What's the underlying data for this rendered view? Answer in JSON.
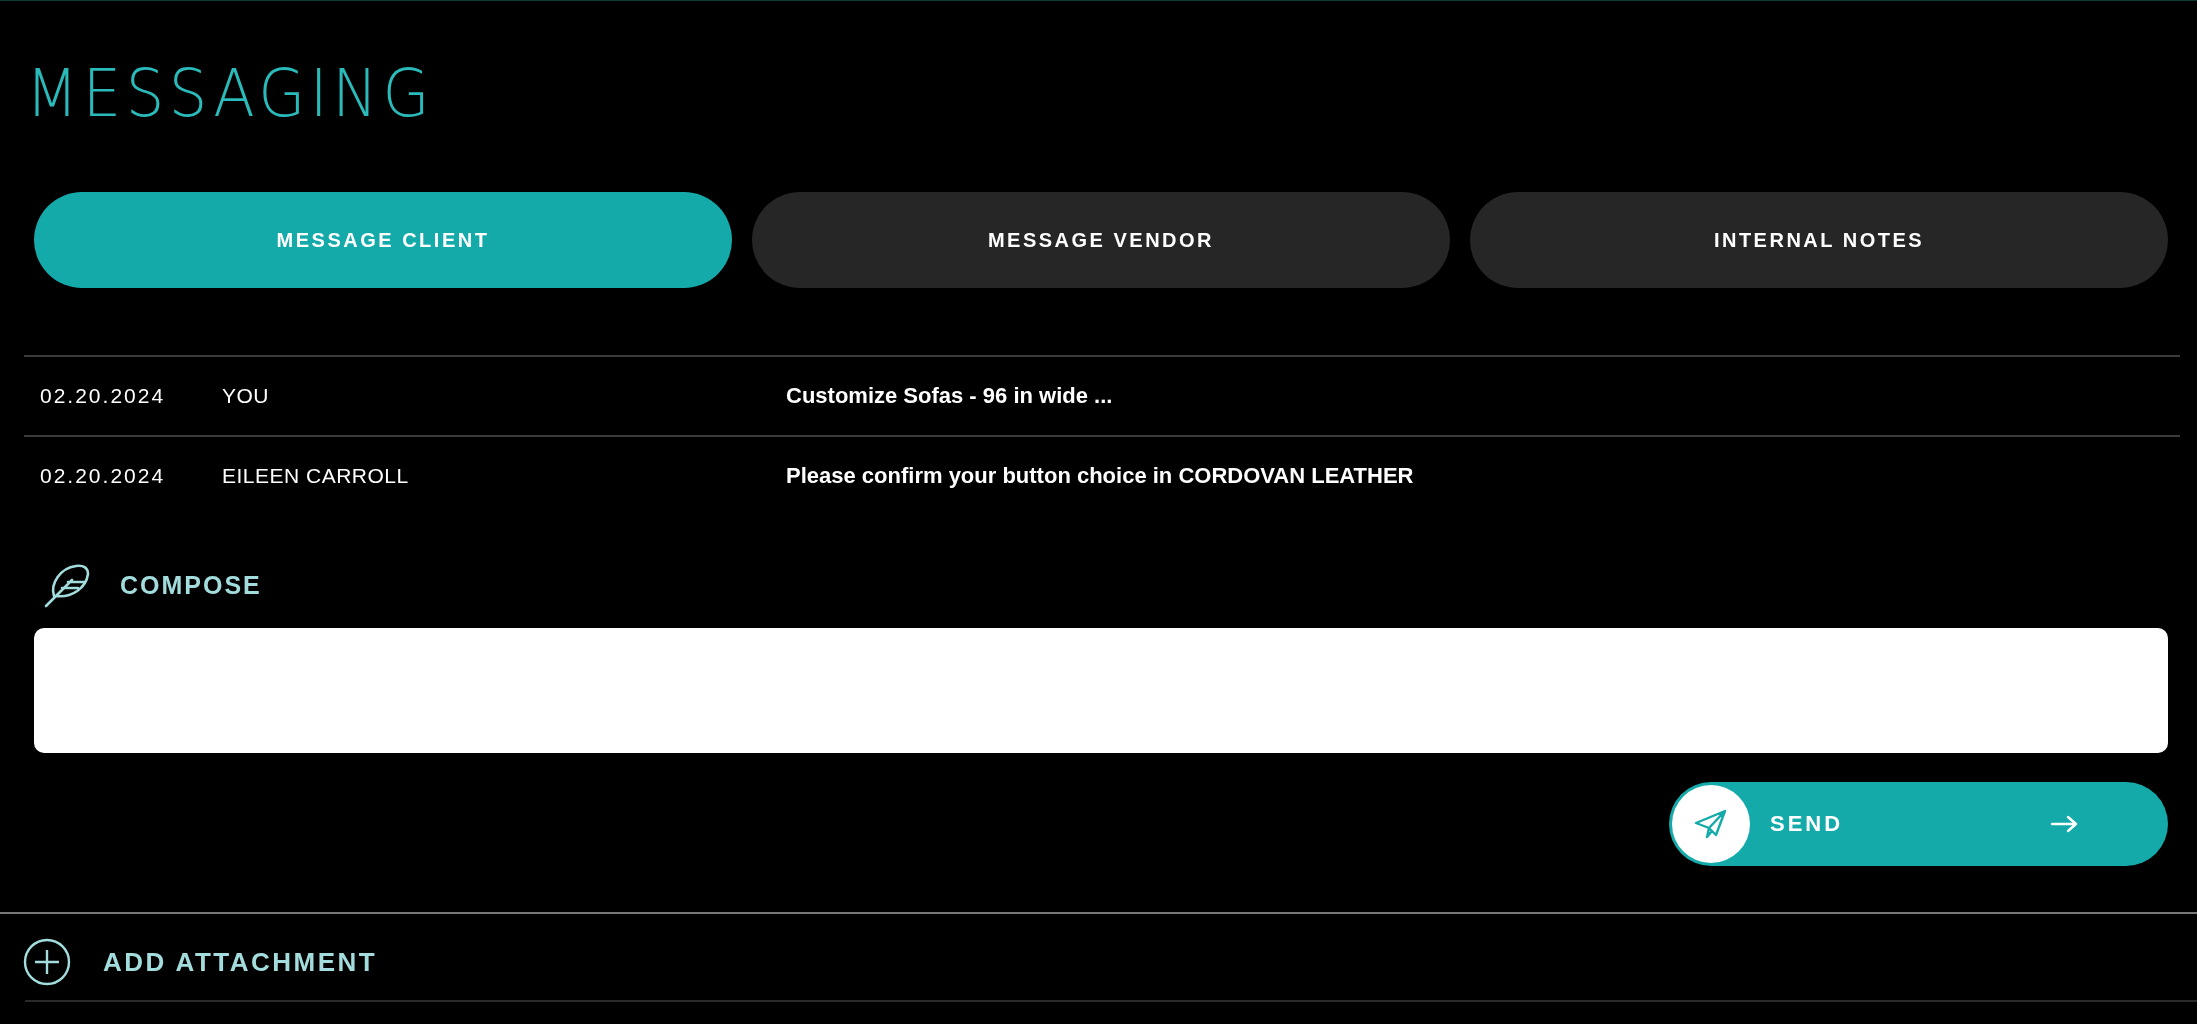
{
  "title": "MESSAGING",
  "tabs": [
    {
      "label": "MESSAGE CLIENT",
      "selected": true
    },
    {
      "label": "MESSAGE VENDOR",
      "selected": false
    },
    {
      "label": "INTERNAL NOTES",
      "selected": false
    }
  ],
  "messages": [
    {
      "date": "02.20.2024",
      "sender": "YOU",
      "text": "Customize Sofas - 96 in wide ..."
    },
    {
      "date": "02.20.2024",
      "sender": "EILEEN CARROLL",
      "text": "Please confirm your button choice in CORDOVAN LEATHER"
    }
  ],
  "compose": {
    "label": "COMPOSE"
  },
  "send_button": {
    "label": "SEND"
  },
  "attachment": {
    "label": "ADD ATTACHMENT"
  }
}
